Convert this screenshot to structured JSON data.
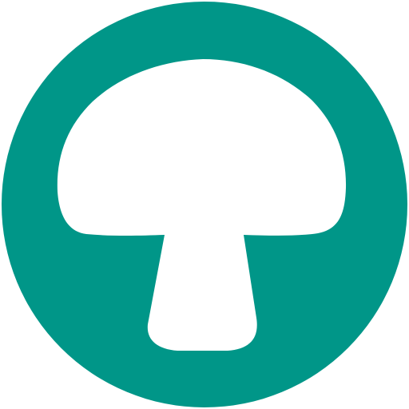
{
  "icon": {
    "name": "mushroom-icon",
    "background_color": "#009688",
    "foreground_color": "#ffffff"
  }
}
